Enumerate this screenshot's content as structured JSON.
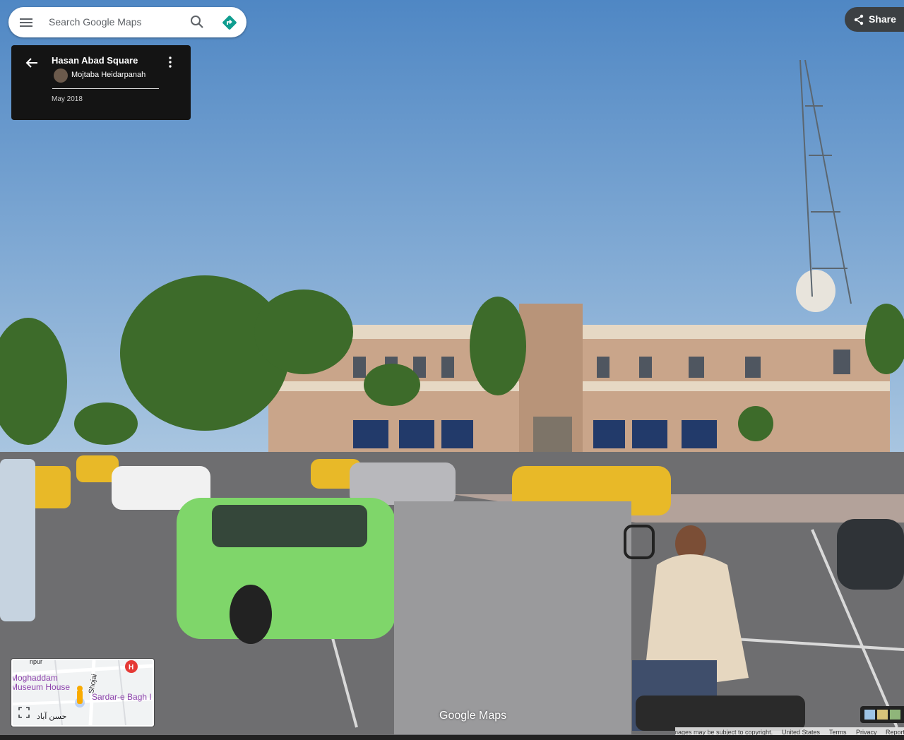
{
  "search": {
    "placeholder": "Search Google Maps"
  },
  "share": {
    "label": "Share"
  },
  "info_card": {
    "title": "Hasan Abad Square",
    "author": "Mojtaba Heidarpanah",
    "date": "May 2018"
  },
  "minimap": {
    "labels": {
      "poi1_line1": "Moghaddam",
      "poi1_line2": "Museum House",
      "street_vertical": "Shojai",
      "poi2": "Sardar-e Bagh I",
      "top_street": "npur",
      "farsi_label": "حسن آباد"
    }
  },
  "brand": {
    "logo": "Google Maps"
  },
  "footer": {
    "copyright": "Images may be subject to copyright.",
    "country": "United States",
    "terms": "Terms",
    "privacy": "Privacy",
    "report": "Report"
  },
  "colors": {
    "accent_directions": "#0f9d8f",
    "card_bg": "#141414",
    "share_bg": "#3c4043"
  }
}
